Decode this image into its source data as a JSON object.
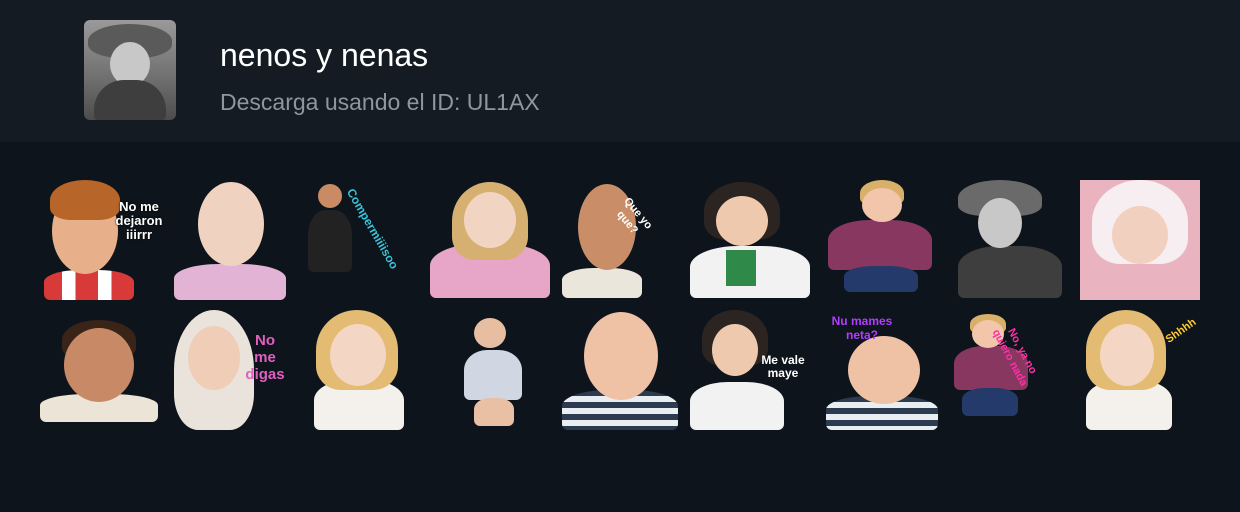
{
  "pack": {
    "title": "nenos y nenas",
    "subtitle": "Descarga usando el ID: UL1AX"
  },
  "stickers": [
    {
      "caption": "No me\ndejaron\niiirrr",
      "caption_color": "#ffffff"
    },
    {
      "caption": ""
    },
    {
      "caption": "Compermiiiisoo",
      "caption_color": "#39c3d8"
    },
    {
      "caption": ""
    },
    {
      "caption": "Que yo que?",
      "caption_color": "#ffffff"
    },
    {
      "caption": ""
    },
    {
      "caption": ""
    },
    {
      "caption": ""
    },
    {
      "caption": ""
    },
    {
      "caption": ""
    },
    {
      "caption": "No\nme\ndigas",
      "caption_color": "#e060c0"
    },
    {
      "caption": ""
    },
    {
      "caption": ""
    },
    {
      "caption": ""
    },
    {
      "caption": "Me vale\nmaye",
      "caption_color": "#ffffff"
    },
    {
      "caption": "Nu mames neta?",
      "caption_color": "#b23cff"
    },
    {
      "caption": "No, ya no quiero nada",
      "caption_color": "#ff2fa6"
    },
    {
      "caption": "Shhhh",
      "caption_color": "#ffcc33"
    }
  ]
}
